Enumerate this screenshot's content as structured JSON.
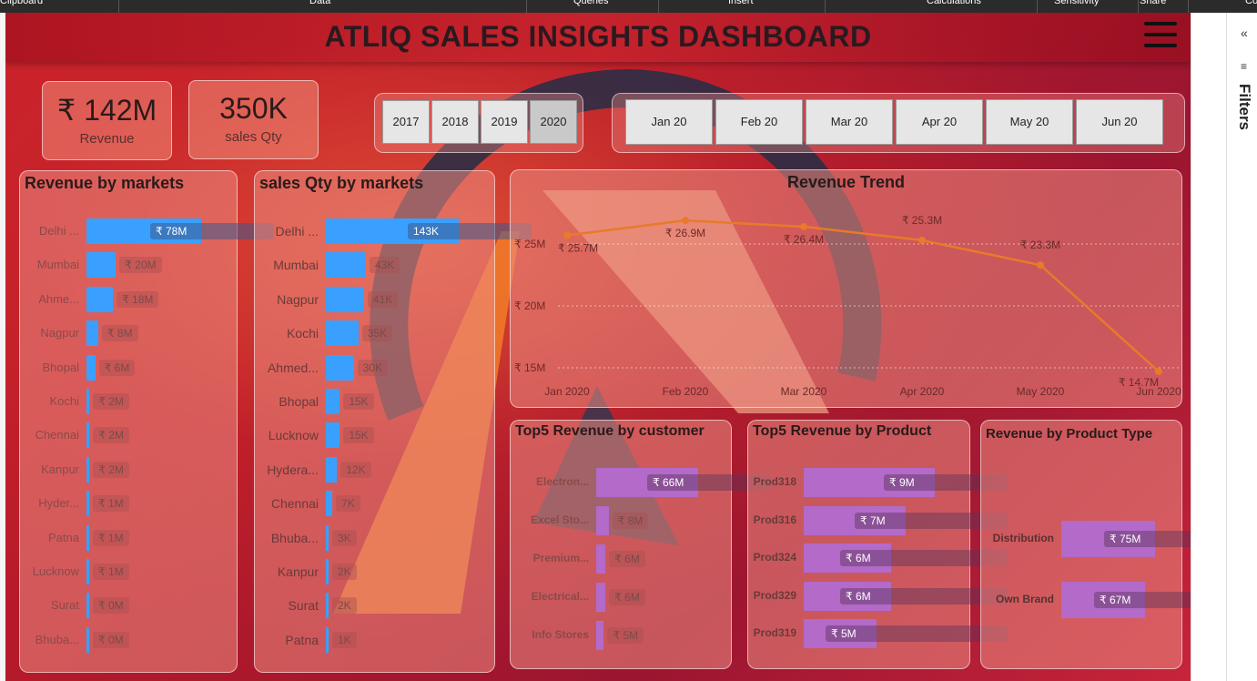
{
  "ribbon": {
    "groups": [
      "Clipboard",
      "Data",
      "Queries",
      "Insert",
      "Calculations",
      "Sensitivity",
      "Share",
      "Co"
    ]
  },
  "header": {
    "title": "ATLIQ SALES INSIGHTS DASHBOARD",
    "menu_icon": "hamburger-menu-icon"
  },
  "kpis": {
    "revenue": {
      "value": "₹ 142M",
      "label": "Revenue"
    },
    "qty": {
      "value": "350K",
      "label": "sales Qty"
    }
  },
  "year_slicer": {
    "options": [
      "2017",
      "2018",
      "2019",
      "2020"
    ],
    "selected": "2020"
  },
  "month_slicer": {
    "options": [
      "Jan 20",
      "Feb 20",
      "Mar 20",
      "Apr 20",
      "May 20",
      "Jun 20"
    ]
  },
  "revenue_by_markets": {
    "title": "Revenue by markets",
    "categories": [
      "Delhi ...",
      "Mumbai",
      "Ahme...",
      "Nagpur",
      "Bhopal",
      "Kochi",
      "Chennai",
      "Kanpur",
      "Hyder...",
      "Patna",
      "Lucknow",
      "Surat",
      "Bhuba..."
    ],
    "labels": [
      "₹ 78M",
      "₹ 20M",
      "₹ 18M",
      "₹ 8M",
      "₹ 6M",
      "₹ 2M",
      "₹ 2M",
      "₹ 2M",
      "₹ 1M",
      "₹ 1M",
      "₹ 1M",
      "₹ 0M",
      "₹ 0M"
    ],
    "bar_color": "#3aa0ff"
  },
  "qty_by_markets": {
    "title": "sales Qty by markets",
    "categories": [
      "Delhi ...",
      "Mumbai",
      "Nagpur",
      "Kochi",
      "Ahmed...",
      "Bhopal",
      "Lucknow",
      "Hydera...",
      "Chennai",
      "Bhuba...",
      "Kanpur",
      "Surat",
      "Patna"
    ],
    "labels": [
      "143K",
      "43K",
      "41K",
      "35K",
      "30K",
      "15K",
      "15K",
      "12K",
      "7K",
      "3K",
      "2K",
      "2K",
      "1K"
    ],
    "bar_color": "#3aa0ff"
  },
  "revenue_trend": {
    "title": "Revenue Trend",
    "y_ticks": [
      "₹ 25M",
      "₹ 20M",
      "₹ 15M"
    ],
    "x_ticks": [
      "Jan 2020",
      "Feb 2020",
      "Mar 2020",
      "Apr 2020",
      "May 2020",
      "Jun 2020"
    ],
    "point_labels": [
      "₹ 25.7M",
      "₹ 26.9M",
      "₹ 26.4M",
      "₹ 25.3M",
      "₹ 23.3M",
      "₹ 14.7M"
    ],
    "line_color": "#e87a2a"
  },
  "top5_customer": {
    "title": "Top5 Revenue by customer",
    "categories": [
      "Electron...",
      "Excel Sto...",
      "Premium...",
      "Electrical...",
      "Info Stores"
    ],
    "labels": [
      "₹ 66M",
      "₹ 8M",
      "₹ 6M",
      "₹ 6M",
      "₹ 5M"
    ],
    "bar_color": "#b36ac8"
  },
  "top5_product": {
    "title": "Top5 Revenue by Product",
    "categories": [
      "Prod318",
      "Prod316",
      "Prod324",
      "Prod329",
      "Prod319"
    ],
    "labels": [
      "₹ 9M",
      "₹ 7M",
      "₹ 6M",
      "₹ 6M",
      "₹ 5M"
    ],
    "bar_color": "#b36ac8"
  },
  "product_type": {
    "title": "Revenue by Product Type",
    "categories": [
      "Distribution",
      "Own Brand"
    ],
    "labels": [
      "₹ 75M",
      "₹ 67M"
    ],
    "bar_color": "#b36ac8"
  },
  "filters_pane": {
    "label": "Filters",
    "collapse_icon": "double-chevron-left-icon"
  },
  "chart_data": [
    {
      "type": "bar",
      "title": "Revenue by markets",
      "categories": [
        "Delhi ...",
        "Mumbai",
        "Ahme...",
        "Nagpur",
        "Bhopal",
        "Kochi",
        "Chennai",
        "Kanpur",
        "Hyder...",
        "Patna",
        "Lucknow",
        "Surat",
        "Bhuba..."
      ],
      "values": [
        78,
        20,
        18,
        8,
        6,
        2,
        2,
        2,
        1,
        1,
        1,
        0,
        0
      ]
    },
    {
      "type": "bar",
      "title": "sales Qty by markets",
      "categories": [
        "Delhi ...",
        "Mumbai",
        "Nagpur",
        "Kochi",
        "Ahmed...",
        "Bhopal",
        "Lucknow",
        "Hydera...",
        "Chennai",
        "Bhuba...",
        "Kanpur",
        "Surat",
        "Patna"
      ],
      "values": [
        143,
        43,
        41,
        35,
        30,
        15,
        15,
        12,
        7,
        3,
        2,
        2,
        1
      ]
    },
    {
      "type": "line",
      "title": "Revenue Trend",
      "x": [
        "Jan 2020",
        "Feb 2020",
        "Mar 2020",
        "Apr 2020",
        "May 2020",
        "Jun 2020"
      ],
      "values": [
        25.7,
        26.9,
        26.4,
        25.3,
        23.3,
        14.7
      ],
      "ylim": [
        14,
        28
      ]
    },
    {
      "type": "bar",
      "title": "Top5 Revenue by customer",
      "categories": [
        "Electron...",
        "Excel Sto...",
        "Premium...",
        "Electrical...",
        "Info Stores"
      ],
      "values": [
        66,
        8,
        6,
        6,
        5
      ]
    },
    {
      "type": "bar",
      "title": "Top5 Revenue by Product",
      "categories": [
        "Prod318",
        "Prod316",
        "Prod324",
        "Prod329",
        "Prod319"
      ],
      "values": [
        9,
        7,
        6,
        6,
        5
      ]
    },
    {
      "type": "bar",
      "title": "Revenue by Product Type",
      "categories": [
        "Distribution",
        "Own Brand"
      ],
      "values": [
        75,
        67
      ]
    }
  ]
}
